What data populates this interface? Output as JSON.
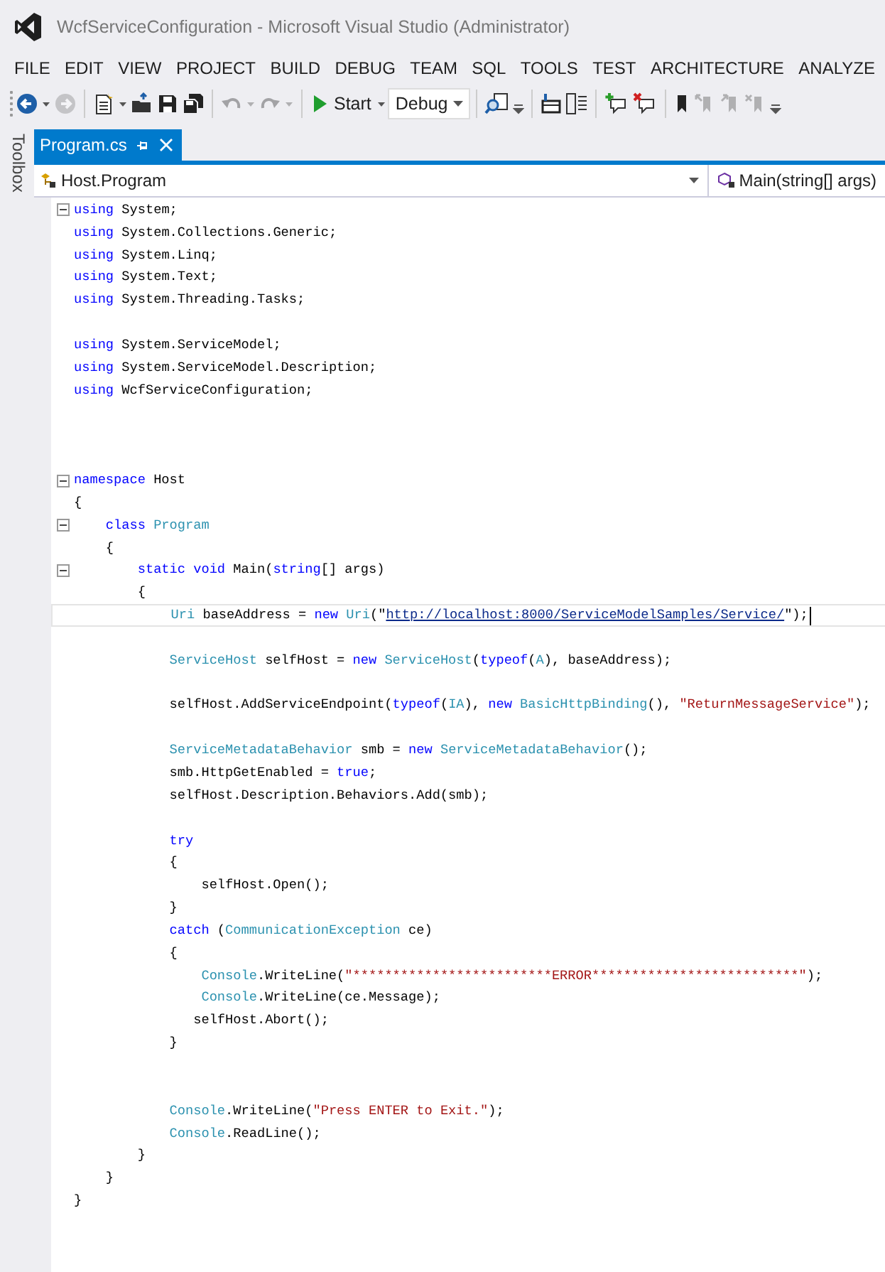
{
  "window": {
    "title": "WcfServiceConfiguration - Microsoft Visual Studio (Administrator)"
  },
  "menu": [
    "FILE",
    "EDIT",
    "VIEW",
    "PROJECT",
    "BUILD",
    "DEBUG",
    "TEAM",
    "SQL",
    "TOOLS",
    "TEST",
    "ARCHITECTURE",
    "ANALYZE"
  ],
  "toolbar": [
    {
      "items": [
        {
          "kind": "back",
          "disabled": false
        },
        {
          "kind": "dropdown",
          "disabled": false
        },
        {
          "kind": "forward",
          "disabled": true
        }
      ]
    },
    {
      "items": [
        {
          "kind": "new",
          "disabled": false
        },
        {
          "kind": "dropdown",
          "disabled": false
        },
        {
          "kind": "open",
          "disabled": false
        },
        {
          "kind": "save",
          "disabled": false
        },
        {
          "kind": "saveall",
          "disabled": false
        }
      ]
    },
    {
      "items": [
        {
          "kind": "undo",
          "disabled": true
        },
        {
          "kind": "dropdown",
          "disabled": true
        },
        {
          "kind": "redo",
          "disabled": true
        },
        {
          "kind": "dropdown",
          "disabled": true
        }
      ]
    },
    {
      "items": [
        {
          "kind": "start",
          "label": "Start",
          "disabled": false
        },
        {
          "kind": "dropdown",
          "disabled": false
        },
        {
          "kind": "combo",
          "value": "Debug",
          "disabled": false
        }
      ]
    },
    {
      "items": [
        {
          "kind": "find",
          "disabled": false
        },
        {
          "kind": "overflow",
          "disabled": false
        }
      ]
    },
    {
      "items": [
        {
          "kind": "panel",
          "disabled": false
        },
        {
          "kind": "list",
          "disabled": false
        }
      ]
    },
    {
      "items": [
        {
          "kind": "comment-add",
          "disabled": false
        },
        {
          "kind": "comment-remove",
          "disabled": false
        }
      ]
    },
    {
      "items": [
        {
          "kind": "bookmark",
          "disabled": false
        },
        {
          "kind": "bookmark-prev",
          "disabled": true
        },
        {
          "kind": "bookmark-next",
          "disabled": true
        },
        {
          "kind": "bookmark-clear",
          "disabled": true
        },
        {
          "kind": "overflow",
          "disabled": false
        }
      ]
    }
  ],
  "side_panel": {
    "label": "Toolbox"
  },
  "tabs": [
    {
      "label": "Program.cs",
      "selected": true
    }
  ],
  "navigation_bar": {
    "type": "Host.Program",
    "member": "Main(string[] args)"
  },
  "code": {
    "lines": [
      {
        "expanded": true,
        "current": false,
        "tokens": [
          {
            "kind": "keyword",
            "text": "using"
          },
          {
            "kind": "plain",
            "text": " System;"
          }
        ]
      },
      {
        "current": false,
        "tokens": [
          {
            "kind": "keyword",
            "text": "using"
          },
          {
            "kind": "plain",
            "text": " System.Collections.Generic;"
          }
        ]
      },
      {
        "current": false,
        "tokens": [
          {
            "kind": "keyword",
            "text": "using"
          },
          {
            "kind": "plain",
            "text": " System.Linq;"
          }
        ]
      },
      {
        "current": false,
        "tokens": [
          {
            "kind": "keyword",
            "text": "using"
          },
          {
            "kind": "plain",
            "text": " System.Text;"
          }
        ]
      },
      {
        "current": false,
        "tokens": [
          {
            "kind": "keyword",
            "text": "using"
          },
          {
            "kind": "plain",
            "text": " System.Threading.Tasks;"
          }
        ]
      },
      {
        "current": false
      },
      {
        "current": false,
        "tokens": [
          {
            "kind": "keyword",
            "text": "using"
          },
          {
            "kind": "plain",
            "text": " System.ServiceModel;"
          }
        ]
      },
      {
        "current": false,
        "tokens": [
          {
            "kind": "keyword",
            "text": "using"
          },
          {
            "kind": "plain",
            "text": " System.ServiceModel.Description;"
          }
        ]
      },
      {
        "current": false,
        "tokens": [
          {
            "kind": "keyword",
            "text": "using"
          },
          {
            "kind": "plain",
            "text": " WcfServiceConfiguration;"
          }
        ]
      },
      {
        "current": false
      },
      {
        "current": false
      },
      {
        "current": false
      },
      {
        "expanded": true,
        "current": false,
        "tokens": [
          {
            "kind": "keyword",
            "text": "namespace"
          },
          {
            "kind": "plain",
            "text": " Host"
          }
        ]
      },
      {
        "current": false,
        "tokens": [
          {
            "kind": "plain",
            "text": "{"
          }
        ]
      },
      {
        "expanded": true,
        "current": false,
        "tokens": [
          {
            "kind": "keyword",
            "text": "    class "
          },
          {
            "kind": "type",
            "text": "Program"
          }
        ]
      },
      {
        "current": false,
        "tokens": [
          {
            "kind": "plain",
            "text": "    {"
          }
        ]
      },
      {
        "expanded": true,
        "current": false,
        "tokens": [
          {
            "kind": "keyword",
            "text": "        static void"
          },
          {
            "kind": "plain",
            "text": " Main("
          },
          {
            "kind": "keyword",
            "text": "string"
          },
          {
            "kind": "plain",
            "text": "[] args)"
          }
        ]
      },
      {
        "current": false,
        "tokens": [
          {
            "kind": "plain",
            "text": "        {"
          }
        ]
      },
      {
        "current": true,
        "tokens": [
          {
            "kind": "type",
            "text": "            Uri"
          },
          {
            "kind": "plain",
            "text": " baseAddress = "
          },
          {
            "kind": "keyword",
            "text": "new "
          },
          {
            "kind": "type",
            "text": "Uri"
          },
          {
            "kind": "plain",
            "text": "(\""
          },
          {
            "kind": "url",
            "text": "http://localhost:8000/ServiceModelSamples/Service/"
          },
          {
            "kind": "plain",
            "text": "\");"
          }
        ]
      },
      {
        "current": false
      },
      {
        "current": false,
        "tokens": [
          {
            "kind": "type",
            "text": "            ServiceHost"
          },
          {
            "kind": "plain",
            "text": " selfHost = "
          },
          {
            "kind": "keyword",
            "text": "new "
          },
          {
            "kind": "type",
            "text": "ServiceHost"
          },
          {
            "kind": "plain",
            "text": "("
          },
          {
            "kind": "keyword",
            "text": "typeof"
          },
          {
            "kind": "plain",
            "text": "("
          },
          {
            "kind": "type",
            "text": "A"
          },
          {
            "kind": "plain",
            "text": "), baseAddress);"
          }
        ]
      },
      {
        "current": false
      },
      {
        "current": false,
        "tokens": [
          {
            "kind": "plain",
            "text": "            selfHost.AddServiceEndpoint("
          },
          {
            "kind": "keyword",
            "text": "typeof"
          },
          {
            "kind": "plain",
            "text": "("
          },
          {
            "kind": "type",
            "text": "IA"
          },
          {
            "kind": "plain",
            "text": "), "
          },
          {
            "kind": "keyword",
            "text": "new "
          },
          {
            "kind": "type",
            "text": "BasicHttpBinding"
          },
          {
            "kind": "plain",
            "text": "(), "
          },
          {
            "kind": "string",
            "text": "\"ReturnMessageService\""
          },
          {
            "kind": "plain",
            "text": ");"
          }
        ]
      },
      {
        "current": false
      },
      {
        "current": false,
        "tokens": [
          {
            "kind": "type",
            "text": "            ServiceMetadataBehavior"
          },
          {
            "kind": "plain",
            "text": " smb = "
          },
          {
            "kind": "keyword",
            "text": "new "
          },
          {
            "kind": "type",
            "text": "ServiceMetadataBehavior"
          },
          {
            "kind": "plain",
            "text": "();"
          }
        ]
      },
      {
        "current": false,
        "tokens": [
          {
            "kind": "plain",
            "text": "            smb.HttpGetEnabled = "
          },
          {
            "kind": "keyword",
            "text": "true"
          },
          {
            "kind": "plain",
            "text": ";"
          }
        ]
      },
      {
        "current": false,
        "tokens": [
          {
            "kind": "plain",
            "text": "            selfHost.Description.Behaviors.Add(smb);"
          }
        ]
      },
      {
        "current": false
      },
      {
        "current": false,
        "tokens": [
          {
            "kind": "keyword",
            "text": "            try"
          }
        ]
      },
      {
        "current": false,
        "tokens": [
          {
            "kind": "plain",
            "text": "            {"
          }
        ]
      },
      {
        "current": false,
        "tokens": [
          {
            "kind": "plain",
            "text": "                selfHost.Open();"
          }
        ]
      },
      {
        "current": false,
        "tokens": [
          {
            "kind": "plain",
            "text": "            }"
          }
        ]
      },
      {
        "current": false,
        "tokens": [
          {
            "kind": "keyword",
            "text": "            catch"
          },
          {
            "kind": "plain",
            "text": " ("
          },
          {
            "kind": "type",
            "text": "CommunicationException"
          },
          {
            "kind": "plain",
            "text": " ce)"
          }
        ]
      },
      {
        "current": false,
        "tokens": [
          {
            "kind": "plain",
            "text": "            {"
          }
        ]
      },
      {
        "current": false,
        "tokens": [
          {
            "kind": "type",
            "text": "                Console"
          },
          {
            "kind": "plain",
            "text": ".WriteLine("
          },
          {
            "kind": "string",
            "text": "\"*************************ERROR**************************\""
          },
          {
            "kind": "plain",
            "text": ");"
          }
        ]
      },
      {
        "current": false,
        "tokens": [
          {
            "kind": "type",
            "text": "                Console"
          },
          {
            "kind": "plain",
            "text": ".WriteLine(ce.Message);"
          }
        ]
      },
      {
        "current": false,
        "tokens": [
          {
            "kind": "plain",
            "text": "               selfHost.Abort();"
          }
        ]
      },
      {
        "current": false,
        "tokens": [
          {
            "kind": "plain",
            "text": "            }"
          }
        ]
      },
      {
        "current": false
      },
      {
        "current": false
      },
      {
        "current": false,
        "tokens": [
          {
            "kind": "type",
            "text": "            Console"
          },
          {
            "kind": "plain",
            "text": ".WriteLine("
          },
          {
            "kind": "string",
            "text": "\"Press ENTER to Exit.\""
          },
          {
            "kind": "plain",
            "text": ");"
          }
        ]
      },
      {
        "current": false,
        "tokens": [
          {
            "kind": "type",
            "text": "            Console"
          },
          {
            "kind": "plain",
            "text": ".ReadLine();"
          }
        ]
      },
      {
        "current": false,
        "tokens": [
          {
            "kind": "plain",
            "text": "        }"
          }
        ]
      },
      {
        "current": false,
        "tokens": [
          {
            "kind": "plain",
            "text": "    }"
          }
        ]
      },
      {
        "current": false,
        "tokens": [
          {
            "kind": "plain",
            "text": "}"
          }
        ]
      }
    ]
  }
}
